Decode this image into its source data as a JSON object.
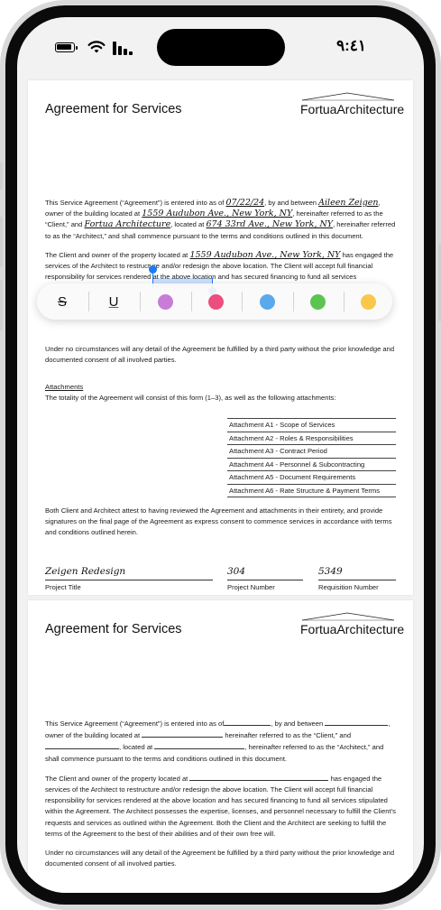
{
  "status_bar": {
    "time": "٩:٤١",
    "battery_icon": "battery-icon",
    "wifi_icon": "wifi-icon",
    "signal_icon": "cellular-signal-icon"
  },
  "page1": {
    "title": "Agreement for Services",
    "logo": "FortuaArchitecture",
    "para1": {
      "t1": "This Service Agreement (“Agreement”) is entered into as of",
      "date": "07/22/24",
      "t2": ", by and between",
      "client": "Aileen Zeigen",
      "t3": ", owner of the building located at",
      "address": "1559 Audubon Ave., New York, NY",
      "t4": ", hereinafter referred to as the “Client,” and",
      "architect": "Fortua Architecture",
      "t5": ", located at",
      "arch_address": "674 33rd Ave., New York, NY",
      "t6": ", hereinafter referred to as the “Architect,” and shall commence pursuant to the terms and conditions outlined in this document."
    },
    "para2": {
      "t1": "The Client and owner of the property located at",
      "address": "1559 Audubon Ave., New York, NY",
      "t2": "has engaged the services of the Architect to restructure and/or redesign the above location. The Client will accept full financial responsibility for services rendered at the above location and has secured financing to fund all services"
    },
    "para3": "Under no circumstances will any detail of the Agreement be fulfilled by a third party without the prior knowledge and documented consent of all involved parties.",
    "attachments_heading": "Attachments",
    "attachments_intro": "The totality of the Agreement will consist of this form (1–3), as well as the following attachments:",
    "attachments": [
      "Attachment A1 - Scope of Services",
      "Attachment A2 - Roles & Responsibilities",
      "Attachment A3 - Contract Period",
      "Attachment A4 - Personnel & Subcontracting",
      "Attachment A5 - Document Requirements",
      "Attachment A6 - Rate Structure & Payment Terms"
    ],
    "para4": "Both Client and Architect attest to having reviewed the Agreement and attachments in their entirety, and provide signatures on the final page of the Agreement as express consent to commence services in accordance with terms and conditions outlined herein.",
    "fields": [
      {
        "label": "Project Title",
        "value": "Zeigen Redesign"
      },
      {
        "label": "Project Number",
        "value": "304"
      },
      {
        "label": "Requisition Number",
        "value": "5349"
      }
    ]
  },
  "page2": {
    "title": "Agreement for Services",
    "logo": "FortuaArchitecture",
    "para1": {
      "t1": "This Service Agreement (“Agreement”) is entered into as of",
      "t2": ", by and between",
      "t3": ", owner of the building located at",
      "t4": "hereinafter referred to as the “Client,” and",
      "t5": ", located at",
      "t6": ", hereinafter referred to as the “Architect,” and shall commence pursuant to the terms and conditions outlined in this document."
    },
    "para2": {
      "t1": "The Client and owner of the property located at",
      "t2": "has engaged the services of the Architect to restructure and/or redesign the above location. The Client will accept full financial responsibility for services rendered at the above location and has secured financing to fund all services stipulated within the Agreement. The Architect possesses the expertise, licenses, and personnel necessary to fulfill the Client’s requests and services as outlined within the Agreement. Both the Client and the Architect are seeking to fulfill the terms of the Agreement to the best of their abilities and of their own free will."
    },
    "para3": "Under no circumstances will any detail of the Agreement be fulfilled by a third party without the prior knowledge and documented consent of all involved parties."
  },
  "toolbar": {
    "strikethrough_label": "S",
    "underline_label": "U",
    "colors": [
      "#c77dd8",
      "#ec4f7d",
      "#5aa9ec",
      "#5cc451",
      "#f9c74a"
    ]
  }
}
